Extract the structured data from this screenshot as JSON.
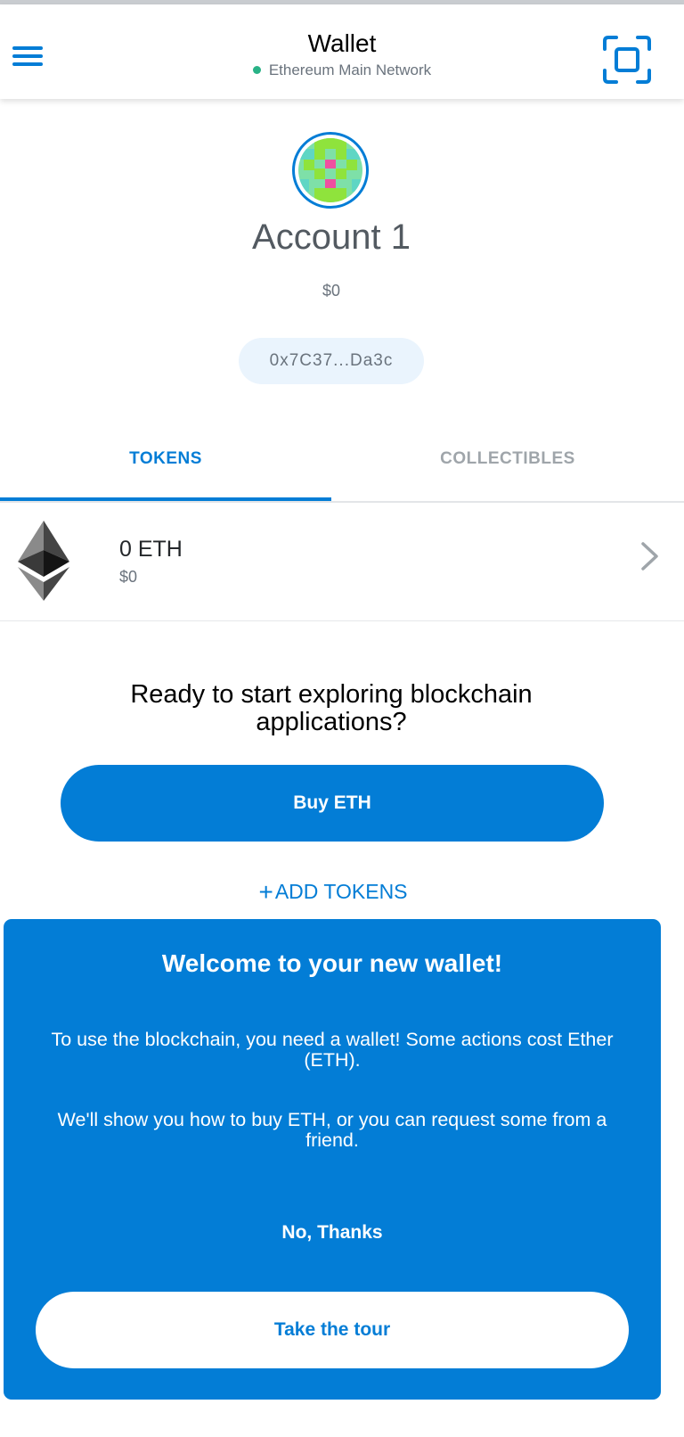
{
  "header": {
    "title": "Wallet",
    "network": "Ethereum Main Network",
    "network_status_color": "#29b286",
    "menu_icon": "hamburger-menu-icon",
    "scan_icon": "qr-scan-icon"
  },
  "account": {
    "name": "Account 1",
    "balance": "$0",
    "address": "0x7C37...Da3c"
  },
  "tabs": [
    {
      "label": "TOKENS",
      "active": true
    },
    {
      "label": "COLLECTIBLES",
      "active": false
    }
  ],
  "tokens": [
    {
      "icon": "ethereum-icon",
      "amount": "0 ETH",
      "fiat": "$0"
    }
  ],
  "explore": {
    "text": "Ready to start exploring blockchain applications?",
    "buy_label": "Buy ETH",
    "add_tokens_plus": "+",
    "add_tokens_label": "ADD TOKENS"
  },
  "welcome_modal": {
    "title": "Welcome to your new wallet!",
    "paragraph1": "To use the blockchain, you need a wallet! Some actions cost Ether (ETH).",
    "paragraph2": "We'll show you how to buy ETH, or you can request some from a friend.",
    "dismiss_label": "No, Thanks",
    "tour_label": "Take the tour"
  },
  "colors": {
    "accent": "#037dd6",
    "inactive_tab": "#9fa5aa",
    "address_pill_bg": "#eaf4fd"
  }
}
